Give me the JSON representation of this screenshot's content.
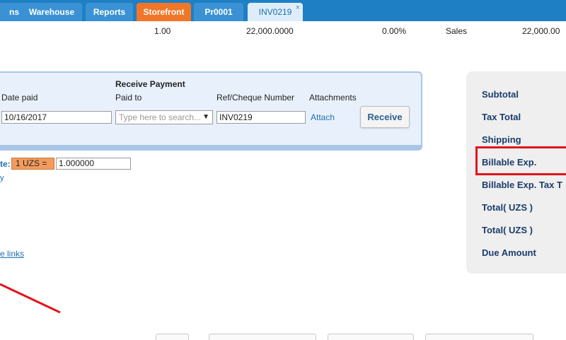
{
  "tabs": [
    {
      "label": "ns",
      "style": "blue"
    },
    {
      "label": "Warehouse",
      "style": "blue"
    },
    {
      "label": "Reports",
      "style": "blue"
    },
    {
      "label": "Storefront",
      "style": "orange"
    },
    {
      "label": "Pr0001",
      "style": "blue"
    },
    {
      "label": "INV0219",
      "style": "active",
      "close": "×"
    }
  ],
  "line_item": {
    "qty": "1.00",
    "price": "22,000.0000",
    "discount": "0.00%",
    "tax_type": "Sales",
    "amount": "22,000.00"
  },
  "payment": {
    "heading": "Receive Payment",
    "date_label": "Date paid",
    "date_value": "10/16/2017",
    "paid_to_label": "Paid to",
    "paid_to_placeholder": "Type here to search...",
    "ref_label": "Ref/Cheque Number",
    "ref_value": "INV0219",
    "attach_label": "Attachments",
    "attach_link": "Attach",
    "receive_button": "Receive"
  },
  "exchange": {
    "label": "te:",
    "currency_badge": "1 UZS =",
    "rate_value": "1.000000",
    "small_link": "y"
  },
  "links_text": "e links",
  "totals": {
    "items": [
      "Subtotal",
      "Tax Total",
      "Shipping",
      "Billable Exp.",
      "Billable Exp. Tax T",
      "Total( UZS )",
      "Total( UZS )",
      "Due Amount"
    ]
  },
  "colors": {
    "tabbar": "#1f7fc5",
    "orange_tab": "#f07628",
    "highlight": "#e1141a",
    "panel_bg": "#e8f1fb"
  }
}
